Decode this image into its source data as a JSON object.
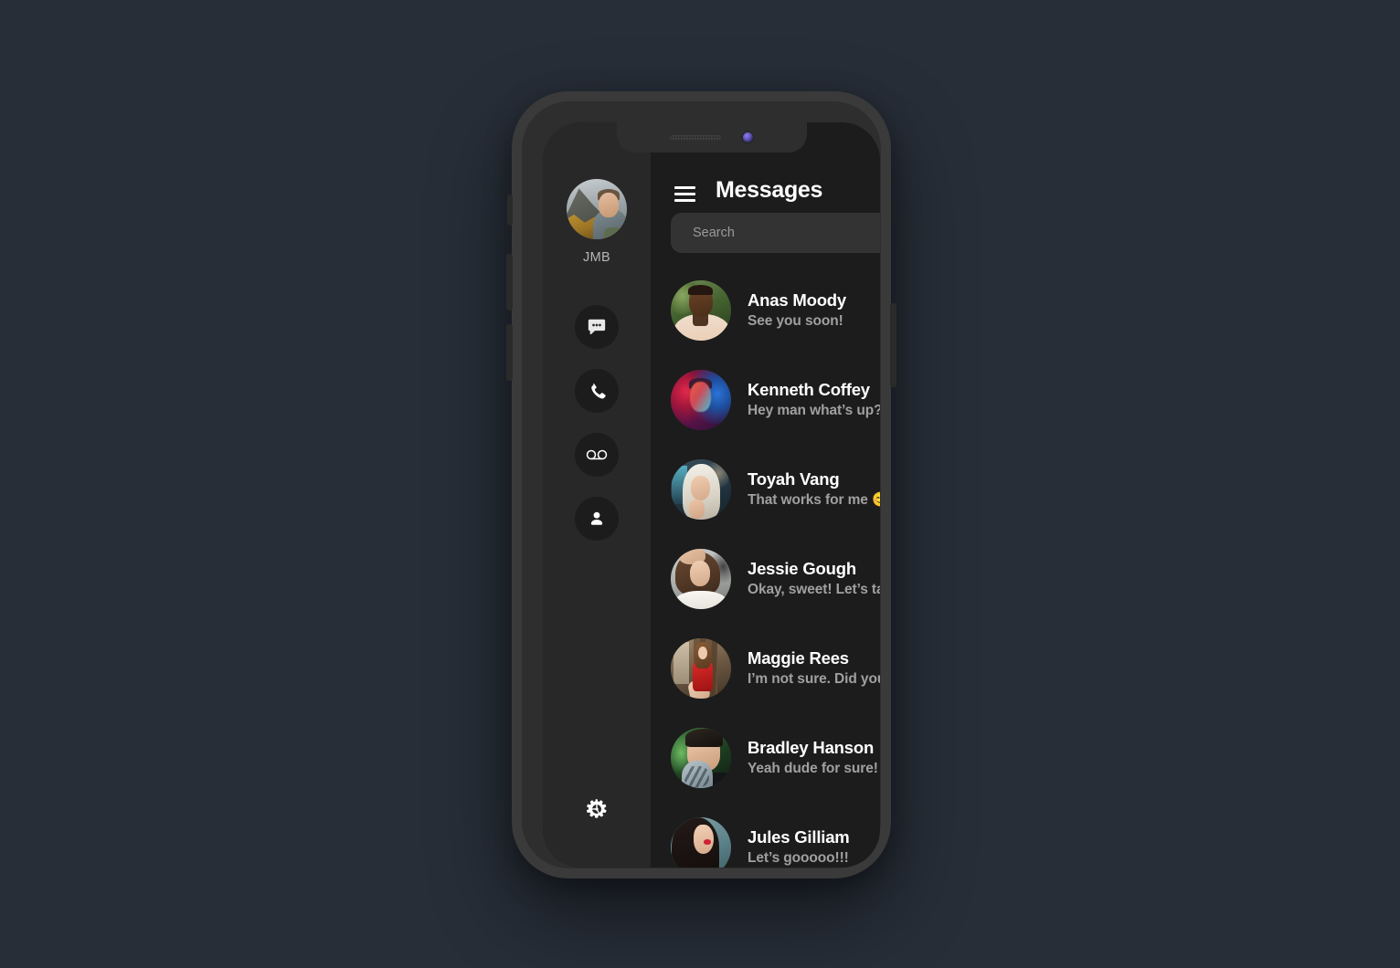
{
  "device": {
    "notch": {
      "speaker": "speaker-grille",
      "camera": "front-camera"
    },
    "buttons": [
      "mute-switch",
      "volume-up",
      "volume-down",
      "power-button"
    ]
  },
  "sidebar": {
    "profile": {
      "name": "JMB",
      "avatar": "jmb-profile-photo"
    },
    "nav_items": [
      {
        "id": "messages",
        "icon": "chat-bubble-icon",
        "active": true
      },
      {
        "id": "calls",
        "icon": "phone-icon",
        "active": false
      },
      {
        "id": "voicemail",
        "icon": "voicemail-icon",
        "active": false
      },
      {
        "id": "contacts",
        "icon": "person-icon",
        "active": false
      }
    ],
    "settings": {
      "icon": "gear-icon"
    }
  },
  "header": {
    "menu_icon": "hamburger-menu-icon",
    "title": "Messages"
  },
  "search": {
    "placeholder": "Search",
    "value": ""
  },
  "conversations": [
    {
      "name": "Anas Moody",
      "preview": "See you soon!",
      "avatar": "anas"
    },
    {
      "name": "Kenneth Coffey",
      "preview": "Hey man what’s up?",
      "avatar": "kenneth"
    },
    {
      "name": "Toyah Vang",
      "preview": "That works for me 😊",
      "avatar": "toyah"
    },
    {
      "name": "Jessie Gough",
      "preview": "Okay, sweet! Let’s talk",
      "avatar": "jessie"
    },
    {
      "name": "Maggie Rees",
      "preview": "I’m not sure. Did you.",
      "avatar": "maggie"
    },
    {
      "name": "Bradley Hanson",
      "preview": "Yeah dude for sure!",
      "avatar": "bradley"
    },
    {
      "name": "Jules Gilliam",
      "preview": "Let’s gooooo!!!",
      "avatar": "jules"
    }
  ],
  "colors": {
    "page_background": "#272e38",
    "device_frame": "#3a3a3a",
    "sidebar_background": "#282828",
    "panel_background": "#1c1c1c",
    "search_background": "#333333",
    "primary_text": "#ffffff",
    "secondary_text": "#a0a0a0",
    "camera_accent": "#6357c4"
  }
}
